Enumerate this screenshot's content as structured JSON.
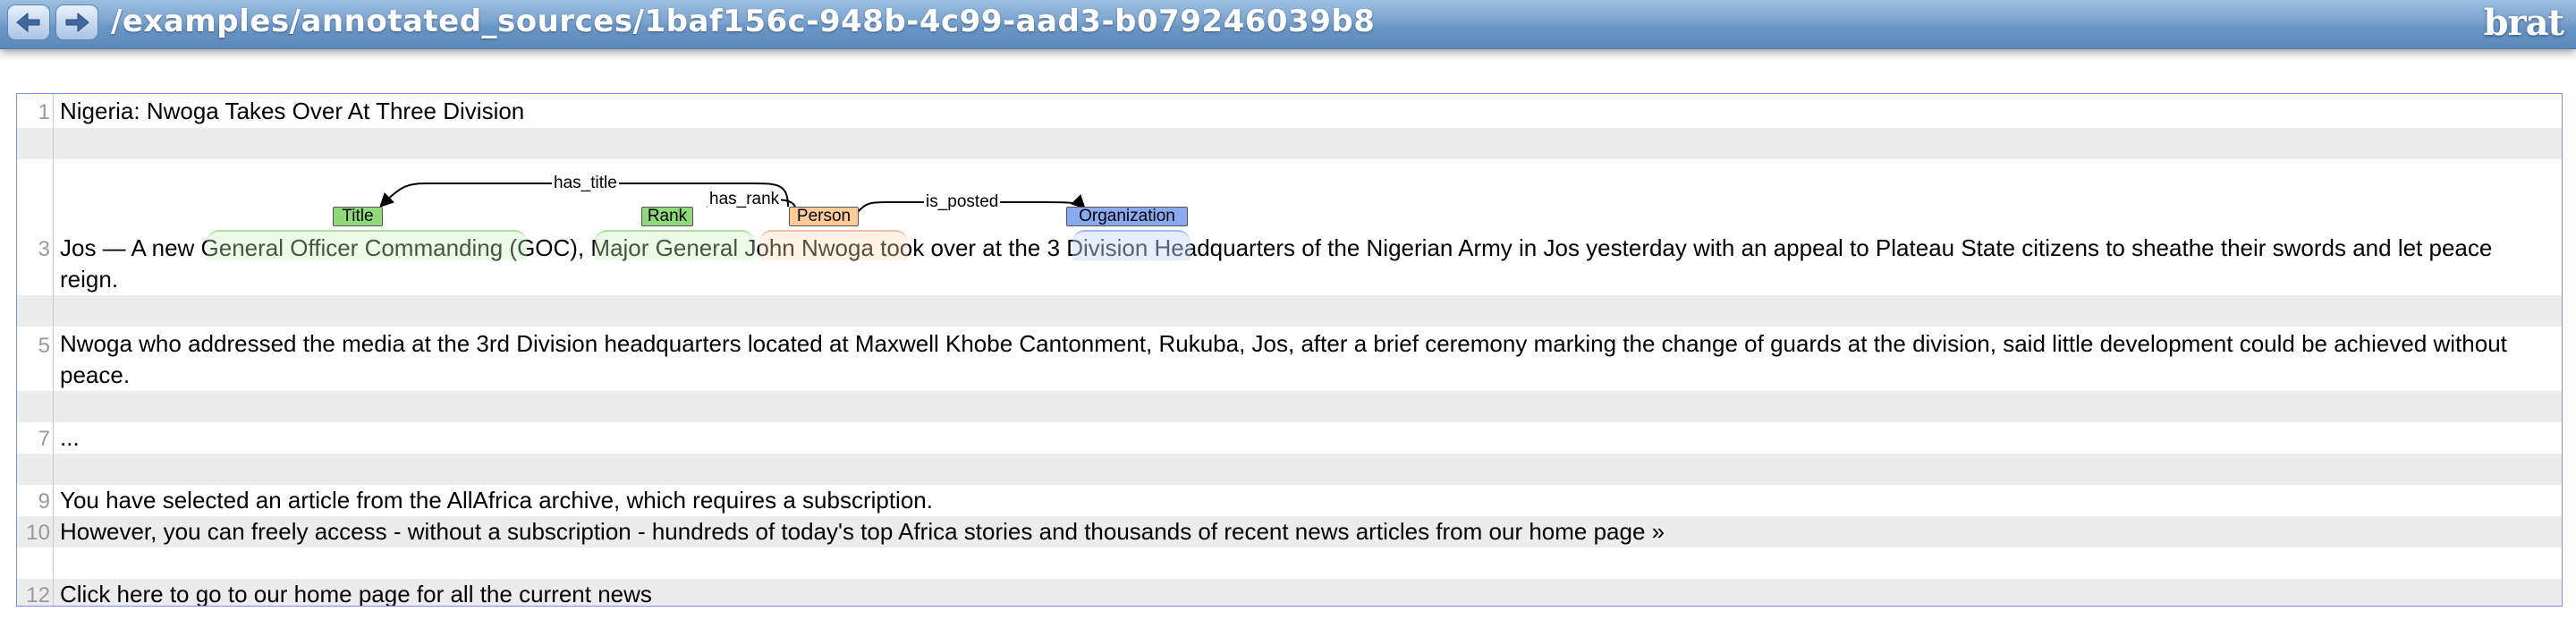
{
  "header": {
    "back_icon": "arrow-left-icon",
    "forward_icon": "arrow-right-icon",
    "path": "/examples/annotated_sources/1baf156c-948b-4c99-aad3-b079246039b8",
    "brand": "brat"
  },
  "lines": [
    {
      "number": "1",
      "text": "Nigeria: Nwoga Takes Over At Three Division"
    },
    {
      "number": "",
      "text": ""
    },
    {
      "number": "3",
      "text": "Jos — A new General Officer Commanding (GOC), Major General  John Nwoga took over at the  3 Division  Headquarters of the Nigerian Army in Jos yesterday with an appeal to Plateau State citizens to sheathe their swords and let peace reign."
    },
    {
      "number": "",
      "text": ""
    },
    {
      "number": "5",
      "text": "Nwoga who addressed the media at the 3rd Division headquarters located at Maxwell Khobe Cantonment, Rukuba, Jos, after a brief ceremony marking the change of guards at the division, said little development could be achieved without peace."
    },
    {
      "number": "",
      "text": ""
    },
    {
      "number": "7",
      "text": "..."
    },
    {
      "number": "",
      "text": ""
    },
    {
      "number": "9",
      "text": "You have selected an article from the AllAfrica archive, which requires a subscription."
    },
    {
      "number": "10",
      "text": "However, you can freely access - without a subscription - hundreds of today's top Africa stories and thousands of recent news articles from our home page »"
    },
    {
      "number": "",
      "text": ""
    },
    {
      "number": "12",
      "text": "Click here to go to our home page for all the current news"
    }
  ],
  "annotations": {
    "entities": [
      {
        "type": "Title",
        "text": "General Officer Commanding",
        "color": "#8fd97a"
      },
      {
        "type": "Rank",
        "text": "Major General",
        "color": "#8fd97a"
      },
      {
        "type": "Person",
        "text": "John Nwoga",
        "color": "#ffcc99"
      },
      {
        "type": "Organization",
        "text": "3 Division",
        "color": "#8aaaf0"
      }
    ],
    "relations": [
      {
        "label": "has_title",
        "from": "Person",
        "to": "Title"
      },
      {
        "label": "has_rank",
        "from": "Person",
        "to": "Rank"
      },
      {
        "label": "is_posted",
        "from": "Person",
        "to": "Organization"
      }
    ]
  }
}
